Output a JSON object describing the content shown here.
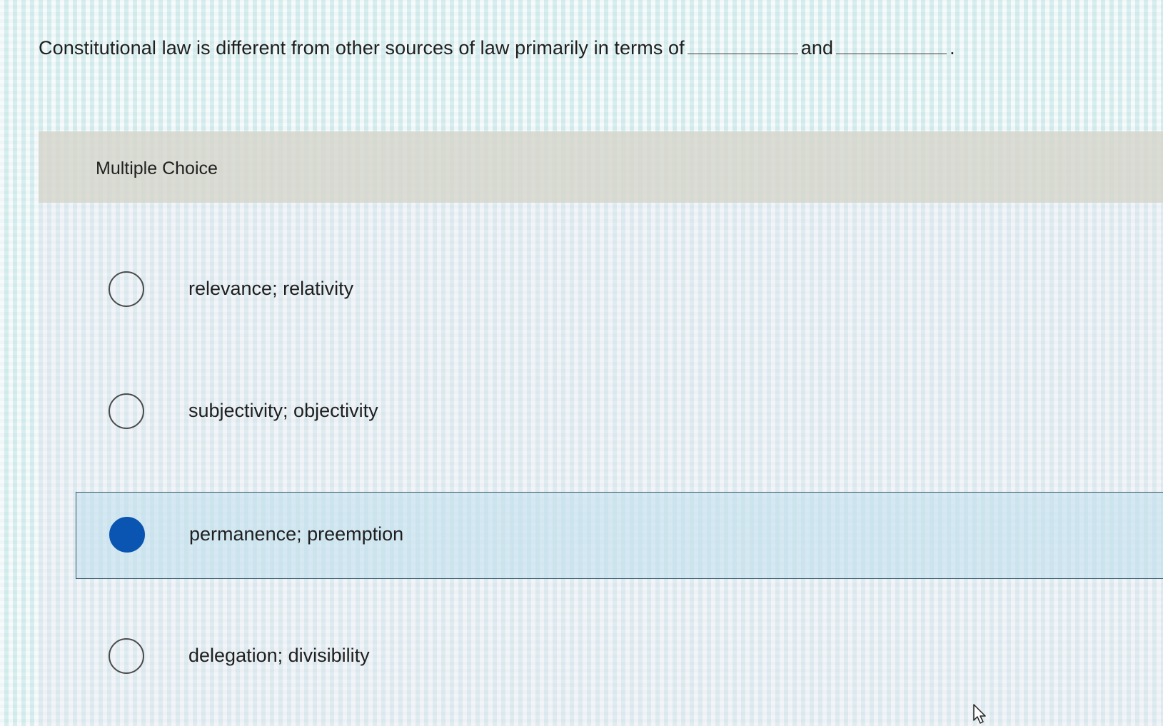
{
  "question": {
    "prefix": "Constitutional law is different from other sources of law primarily in terms of",
    "middle": "and",
    "suffix": "."
  },
  "section": {
    "label": "Multiple Choice"
  },
  "options": [
    {
      "label": "relevance; relativity",
      "selected": false
    },
    {
      "label": "subjectivity; objectivity",
      "selected": false
    },
    {
      "label": "permanence; preemption",
      "selected": true
    },
    {
      "label": "delegation; divisibility",
      "selected": false
    }
  ],
  "colors": {
    "selected_radio": "#0a55b1",
    "selected_border": "#3b5a6e",
    "header_band": "#d6d6cd"
  },
  "icons": {
    "cursor": "pointer-arrow-icon"
  }
}
